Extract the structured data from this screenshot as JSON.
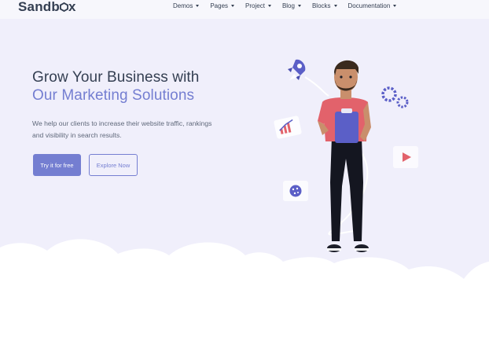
{
  "brand": {
    "name": "Sandbox",
    "name_prefix": "Sandb",
    "name_suffix": "x"
  },
  "nav": {
    "items": [
      {
        "label": "Demos"
      },
      {
        "label": "Pages"
      },
      {
        "label": "Project"
      },
      {
        "label": "Blog"
      },
      {
        "label": "Blocks"
      },
      {
        "label": "Documentation"
      }
    ]
  },
  "hero": {
    "title_line1": "Grow Your Business with",
    "title_line2": "Our Marketing Solutions",
    "description": "We help our clients to increase their website traffic, rankings and visibility in search results.",
    "primary_button": "Try it for free",
    "secondary_button": "Explore Now"
  },
  "colors": {
    "accent": "#747ed1",
    "heading": "#343f52",
    "body": "#60697b",
    "hero_bg": "#f0effb"
  },
  "icons": [
    "chevron-down-icon",
    "rocket-icon",
    "gears-icon",
    "chart-card-icon",
    "play-card-icon",
    "globe-card-icon",
    "hexagon-logo-icon"
  ]
}
